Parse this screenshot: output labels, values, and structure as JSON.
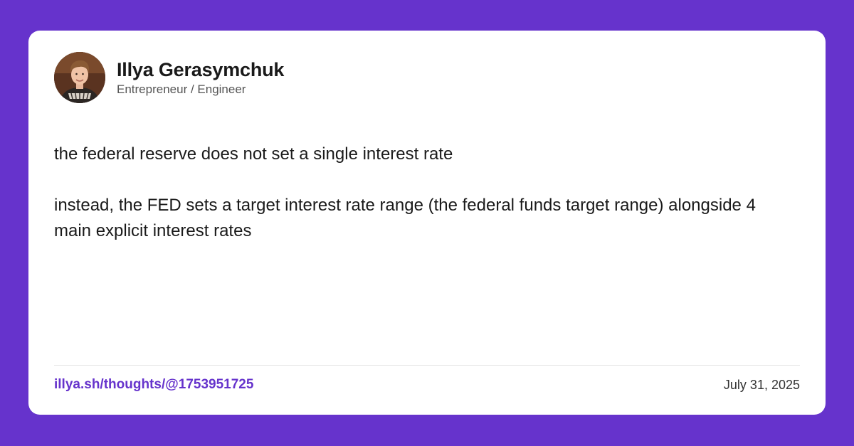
{
  "theme": {
    "background": "#6633cc",
    "card": "#ffffff",
    "accent": "#6633cc"
  },
  "author": {
    "name": "Illya Gerasymchuk",
    "role": "Entrepreneur / Engineer",
    "avatar_icon": "profile-photo"
  },
  "post": {
    "paragraphs": [
      "the federal reserve does not set a single interest rate",
      "instead, the FED sets a target interest rate range (the federal funds target range) alongside 4 main explicit interest rates"
    ]
  },
  "footer": {
    "link": "illya.sh/thoughts/@1753951725",
    "date": "July 31, 2025"
  }
}
